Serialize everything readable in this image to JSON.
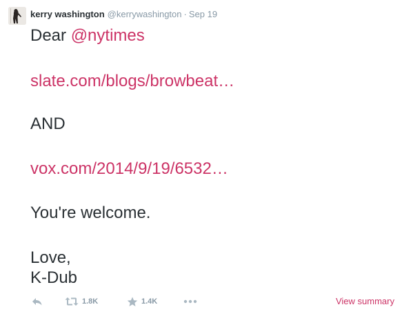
{
  "tweet": {
    "author": {
      "fullname": "kerry washington",
      "username": "@kerrywashington"
    },
    "separator": "·",
    "timestamp": "Sep 19",
    "text": {
      "greeting": "Dear ",
      "mention": "@nytimes",
      "link_1": "slate.com/blogs/browbeat…",
      "conjunction": "AND",
      "link_2": "vox.com/2014/9/19/6532…",
      "closing_1": "You're welcome.",
      "closing_2": "Love,",
      "signature": "K-Dub"
    },
    "actions": {
      "reply_icon": "reply-icon",
      "retweet_icon": "retweet-icon",
      "retweet_count": "1.8K",
      "favorite_icon": "star-icon",
      "favorite_count": "1.4K",
      "more_icon": "more-dots-icon",
      "view_summary": "View summary"
    }
  },
  "colors": {
    "link": "#cc3366",
    "text": "#292f33",
    "muted": "#8899a6"
  }
}
